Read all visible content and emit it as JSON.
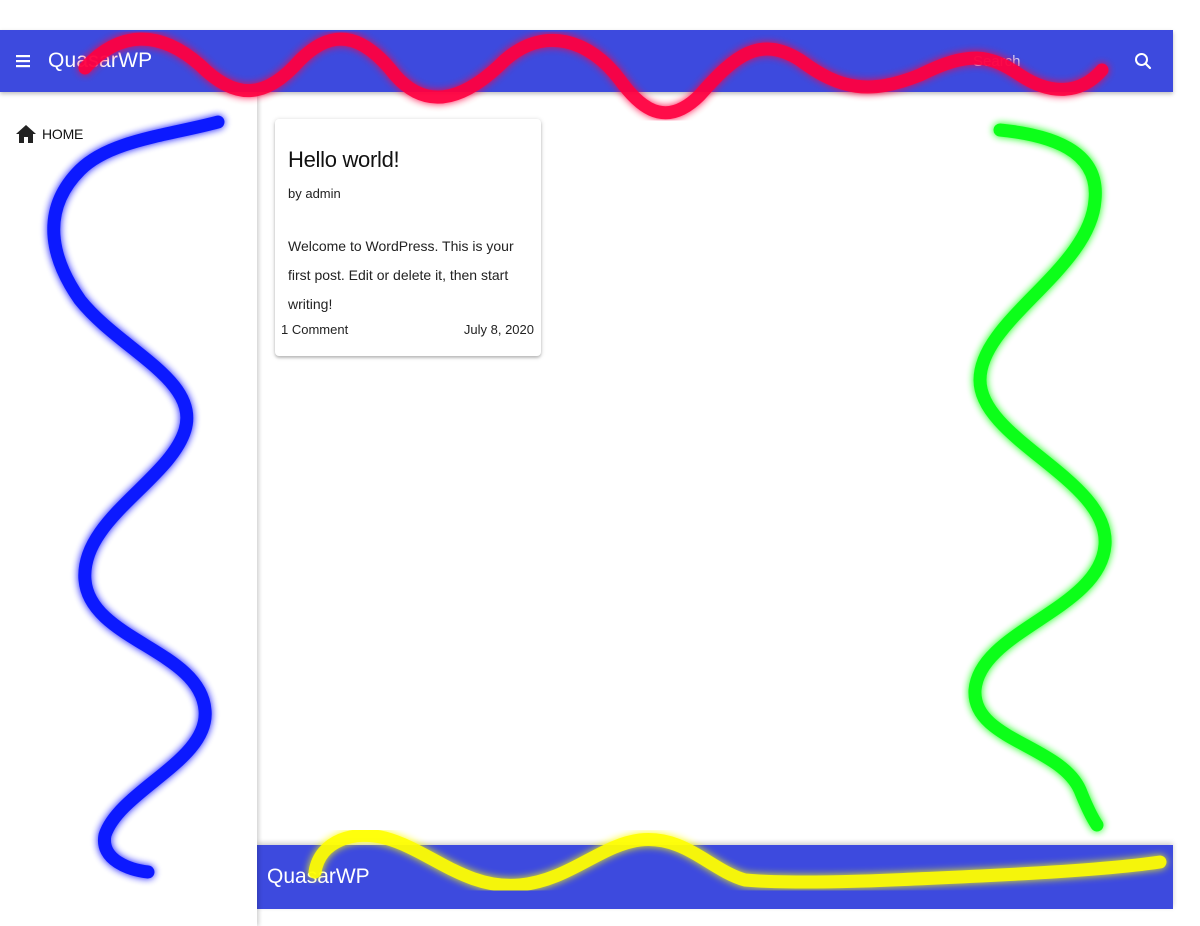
{
  "header": {
    "title": "QuasarWP",
    "search_placeholder": "Search",
    "menu_icon": "menu-icon",
    "search_icon": "search-icon",
    "background_color": "#3d4ade"
  },
  "sidebar": {
    "items": [
      {
        "label": "HOME",
        "icon": "home-icon"
      }
    ]
  },
  "posts": [
    {
      "title": "Hello world!",
      "author": "by admin",
      "excerpt": "Welcome to WordPress. This is your first post. Edit or delete it, then start writing!",
      "comments": "1 Comment",
      "date": "July 8, 2020"
    }
  ],
  "footer": {
    "title": "QuasarWP"
  },
  "annotations": {
    "stroke_colors": [
      "#ff0040",
      "#0010ff",
      "#00ff10",
      "#ffff00"
    ]
  }
}
